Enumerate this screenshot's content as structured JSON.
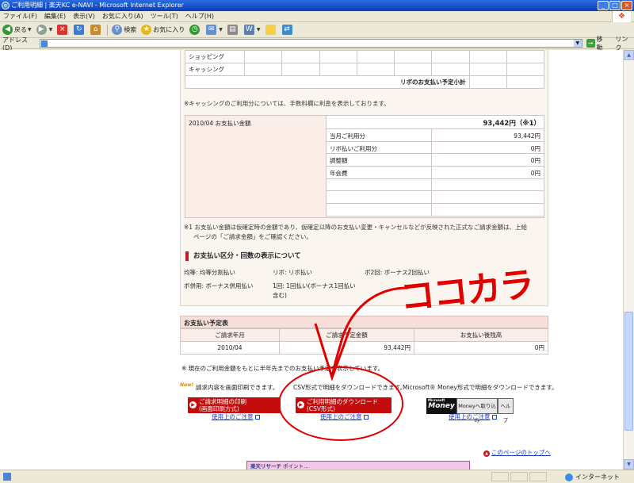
{
  "window": {
    "title": "ご利用明細 | 楽天KC e-NAVI - Microsoft Internet Explorer"
  },
  "menu": [
    "ファイル(F)",
    "編集(E)",
    "表示(V)",
    "お気に入り(A)",
    "ツール(T)",
    "ヘルプ(H)"
  ],
  "toolbar": {
    "back": "戻る",
    "search": "検索",
    "favorites": "お気に入り"
  },
  "address": {
    "label": "アドレス(D)",
    "go": "移動",
    "links": "リンク"
  },
  "grid1": {
    "rows": [
      "ショッピング",
      "キャッシング"
    ],
    "subtotal": "リボのお支払い予定小計"
  },
  "note_cashing": "※キャッシングのご利用分については、手数料欄に利息を表示しております。",
  "bill": {
    "month_label": "2010/04 お支払い金額",
    "total": "93,442円（※1）",
    "rows": [
      {
        "k": "当月ご利用分",
        "v": "93,442円"
      },
      {
        "k": "リボ払いご利用分",
        "v": "0円"
      },
      {
        "k": "調整額",
        "v": "0円"
      },
      {
        "k": "年会費",
        "v": "0円"
      },
      {
        "k": "",
        "v": ""
      },
      {
        "k": "",
        "v": ""
      },
      {
        "k": "",
        "v": ""
      }
    ]
  },
  "note1_line1": "※1 お支払い金額は仮確定時の金額であり、仮確定以降のお支払い変更・キャンセルなどが反映された正式なご請求金額は、上給",
  "note1_line2": "ページの「ご請求金額」をご確認ください。",
  "section_title": "お支払い区分・回数の表示について",
  "classes": {
    "c1": "均等: 均等分割払い",
    "c2": "リボ: リボ払い",
    "c3": "ボ2回: ボーナス2回払い",
    "c4": "ボ併用: ボーナス併用払い",
    "c5a": "1回: 1回払い(ボーナス1回払い",
    "c5b": "含む)"
  },
  "schedule": {
    "title": "お支払い予定表",
    "headers": [
      "ご請求年月",
      "ご請求予定金額",
      "お支払い後残高"
    ],
    "rows": [
      {
        "month": "2010/04",
        "amount": "93,442円",
        "balance": "0円"
      }
    ]
  },
  "footnote": "※ 現在のご利用金額をもとに半年先までのお支払い予定を表示しています。",
  "downloads": {
    "new_badge": "New!",
    "print_desc": "請求内容を画面印刷できます。",
    "print_btn_1": "ご請求明細の印刷",
    "print_btn_2": "(画面印刷方式)",
    "csv_desc": "CSV形式で明細をダウンロードできます。",
    "csv_btn_1": "ご利用明細のダウンロード",
    "csv_btn_2": "(CSV形式)",
    "money_desc": "Microsoft® Money形式で明細をダウンロードできます。",
    "money_logo_small": "Microsoft",
    "money_logo": "Money",
    "money_import": "Moneyへ取り込み",
    "money_help": "ヘルプ",
    "caution": "使用上のご注意"
  },
  "page_top": "このページのトップへ",
  "banner": {
    "brand": "楽天リサーチ",
    "text": "ポイント…"
  },
  "annotation": {
    "text": "ココカラ",
    "color": "#e00000"
  },
  "status": {
    "zone": "インターネット"
  }
}
